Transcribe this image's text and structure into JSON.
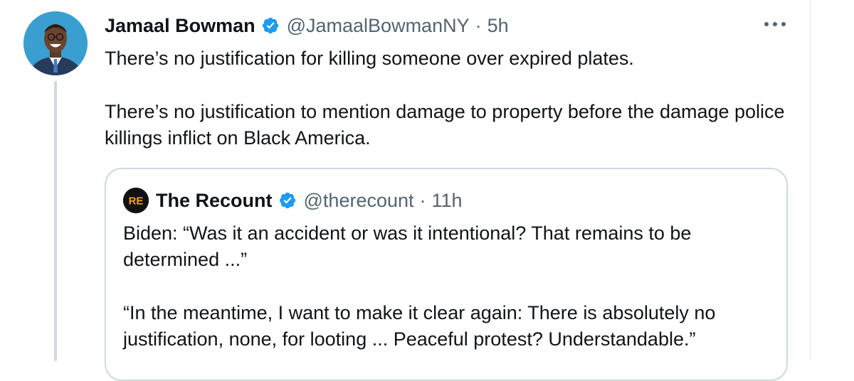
{
  "tweet": {
    "author_name": "Jamaal Bowman",
    "handle": "@JamaalBowmanNY",
    "separator": "·",
    "time": "5h",
    "paragraphs": [
      "There’s no justification for killing someone over expired plates.",
      "There’s no justification to mention damage to property before the damage police killings inflict on Black America."
    ]
  },
  "quoted_tweet": {
    "author_name": "The Recount",
    "handle": "@therecount",
    "separator": "·",
    "time": "11h",
    "logo_text": "RE",
    "paragraphs": [
      "Biden: “Was it an accident or was it intentional? That remains to be determined ...”",
      "“In the meantime, I want to make it clear again: There is absolutely no justification, none, for looting ... Peaceful protest? Understandable.”"
    ]
  },
  "icons": {
    "verified": "verified-badge-icon",
    "more": "more-options-icon"
  },
  "colors": {
    "verified_blue": "#1d9bf0",
    "secondary_text": "#536471",
    "border": "#cfd9de",
    "logo_accent": "#f5a623"
  }
}
